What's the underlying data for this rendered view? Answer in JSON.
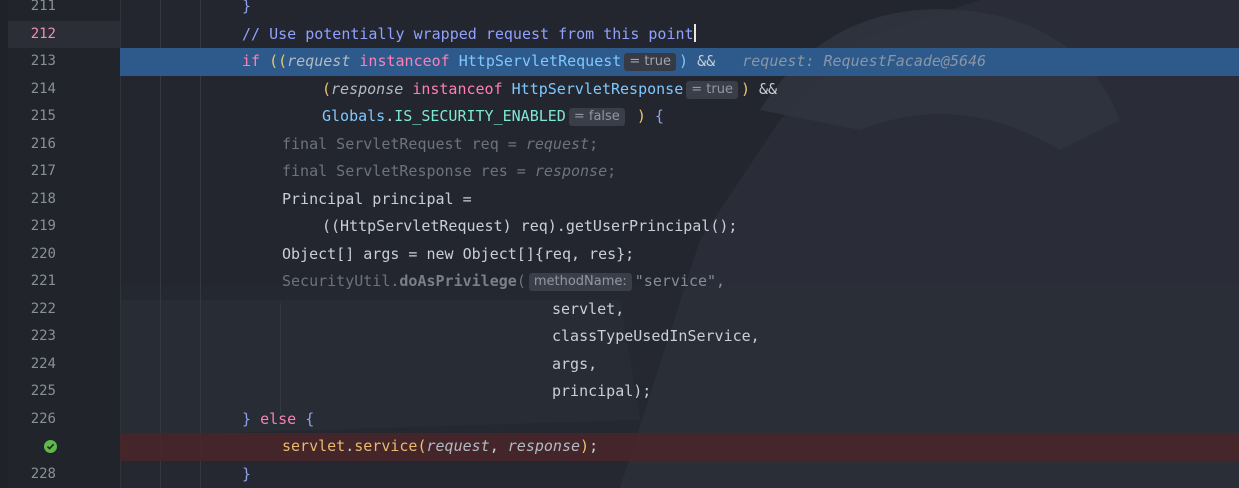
{
  "colors": {
    "background": "#23262e",
    "gutter": "#21242b",
    "execution_line": "#2d5a8a",
    "breakpoint_line": "#4a2529",
    "keyword": "#ff7eb6",
    "class": "#7ec8ff",
    "comment": "#8fa1ff",
    "method": "#e9b96e",
    "current_line_number": "#f28fb0",
    "breakpoint_check": "#5fb84a"
  },
  "icons": {
    "breakpoint": "check-circle-icon"
  },
  "lines": [
    {
      "number": "211",
      "brace": "}"
    },
    {
      "number": "212",
      "comment": "// Use potentially wrapped request from this point"
    },
    {
      "number": "213",
      "kw_if": "if",
      "open": "((",
      "param": "request",
      "kw_instanceof": "instanceof",
      "cls": "HttpServletRequest",
      "hint": "= true",
      "close": ")",
      "op": "&&",
      "inline_value": "request: RequestFacade@5646"
    },
    {
      "number": "214",
      "open": "(",
      "param": "response",
      "kw_instanceof": "instanceof",
      "cls": "HttpServletResponse",
      "hint": "= true",
      "close": ")",
      "op": "&&"
    },
    {
      "number": "215",
      "cls": "Globals",
      "dot": ".",
      "const": "IS_SECURITY_ENABLED",
      "hint": "= false",
      "close": ")",
      "brace": "{"
    },
    {
      "number": "216",
      "text_a": "final ServletRequest req = ",
      "param": "request",
      "text_b": ";"
    },
    {
      "number": "217",
      "text_a": "final ServletResponse res = ",
      "param": "response",
      "text_b": ";"
    },
    {
      "number": "218",
      "text": "Principal principal ="
    },
    {
      "number": "219",
      "text": "((HttpServletRequest) req).getUserPrincipal();"
    },
    {
      "number": "220",
      "text": "Object[] args = new Object[]{req, res};"
    },
    {
      "number": "221",
      "text_a": "SecurityUtil.",
      "method": "doAsPrivilege",
      "text_b": "(",
      "hint": "methodName:",
      "str": "\"service\","
    },
    {
      "number": "222",
      "text": "servlet,"
    },
    {
      "number": "223",
      "text": "classTypeUsedInService,"
    },
    {
      "number": "224",
      "text": "args,"
    },
    {
      "number": "225",
      "text": "principal);"
    },
    {
      "number": "226",
      "brace_close": "}",
      "kw_else": "else",
      "brace_open": "{"
    },
    {
      "number": "",
      "obj": "servlet",
      "dot": ".",
      "method": "service",
      "open": "(",
      "param1": "request",
      "comma": ", ",
      "param2": "response",
      "close": ")",
      "semi": ";"
    },
    {
      "number": "228",
      "brace": "}"
    }
  ]
}
